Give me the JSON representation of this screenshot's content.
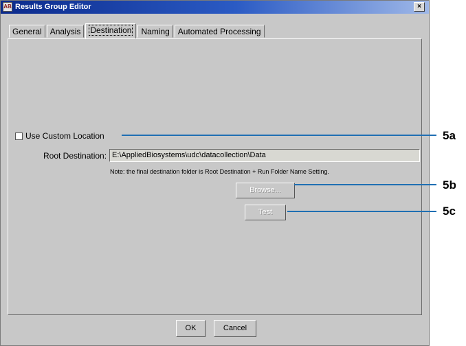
{
  "window": {
    "title": "Results Group Editor",
    "icon_text": "AB",
    "close_glyph": "×"
  },
  "tabs": [
    {
      "label": "General",
      "active": false
    },
    {
      "label": "Analysis",
      "active": false
    },
    {
      "label": "Destination",
      "active": true
    },
    {
      "label": "Naming",
      "active": false
    },
    {
      "label": "Automated Processing",
      "active": false
    }
  ],
  "destination": {
    "use_custom_location_label": "Use Custom Location",
    "use_custom_location_checked": false,
    "root_destination_label": "Root Destination:",
    "root_destination_value": "E:\\AppliedBiosystems\\udc\\datacollection\\Data",
    "note": "Note: the final destination folder is Root Destination + Run Folder Name Setting.",
    "browse_label": "Browse...",
    "test_label": "Test"
  },
  "footer": {
    "ok_label": "OK",
    "cancel_label": "Cancel"
  },
  "callouts": {
    "a": "5a",
    "b": "5b",
    "c": "5c"
  },
  "colors": {
    "titlebar_start": "#0b2a8c",
    "callout_line": "#1f6fb3",
    "window_bg": "#c8c8c8"
  }
}
